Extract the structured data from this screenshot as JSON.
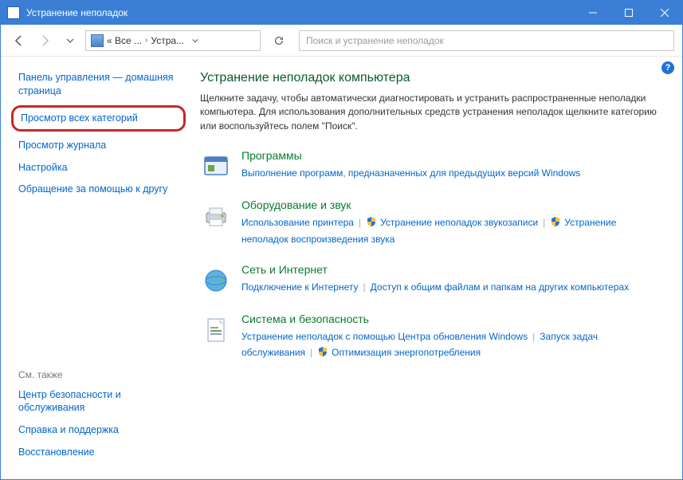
{
  "titlebar": {
    "title": "Устранение неполадок"
  },
  "addr": {
    "crumb1": "« Все ...",
    "crumb2": "Устра...",
    "search_placeholder": "Поиск и устранение неполадок"
  },
  "sidebar": {
    "links": [
      "Панель управления — домашняя страница",
      "Просмотр всех категорий",
      "Просмотр журнала",
      "Настройка",
      "Обращение за помощью к другу"
    ],
    "see_also_header": "См. также",
    "see_also": [
      "Центр безопасности и обслуживания",
      "Справка и поддержка",
      "Восстановление"
    ]
  },
  "main": {
    "heading": "Устранение неполадок компьютера",
    "desc": "Щелкните задачу, чтобы автоматически диагностировать и устранить распространенные неполадки компьютера. Для использования дополнительных средств устранения неполадок щелкните категорию или воспользуйтесь полем \"Поиск\".",
    "cats": [
      {
        "title": "Программы",
        "subs": [
          {
            "text": "Выполнение программ, предназначенных для предыдущих версий Windows",
            "shield": false
          }
        ]
      },
      {
        "title": "Оборудование и звук",
        "subs": [
          {
            "text": "Использование принтера",
            "shield": false
          },
          {
            "text": "Устранение неполадок звукозаписи",
            "shield": true
          },
          {
            "text": "Устранение неполадок воспроизведения звука",
            "shield": true
          }
        ]
      },
      {
        "title": "Сеть и Интернет",
        "subs": [
          {
            "text": "Подключение к Интернету",
            "shield": false
          },
          {
            "text": "Доступ к общим файлам и папкам на других компьютерах",
            "shield": false
          }
        ]
      },
      {
        "title": "Система и безопасность",
        "subs": [
          {
            "text": "Устранение неполадок с помощью Центра обновления Windows",
            "shield": false
          },
          {
            "text": "Запуск задач обслуживания",
            "shield": false
          },
          {
            "text": "Оптимизация энергопотребления",
            "shield": true
          }
        ]
      }
    ]
  }
}
